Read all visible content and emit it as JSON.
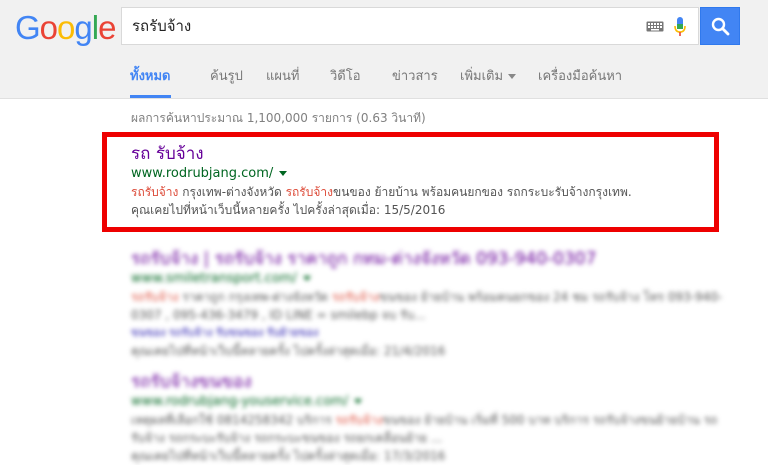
{
  "colors": {
    "accent": "#4285f4",
    "highlight": "#ee0000",
    "visited_link": "#660099",
    "url_green": "#006621",
    "query_red": "#dd4b39"
  },
  "header": {
    "logo_letters": [
      "G",
      "o",
      "o",
      "g",
      "l",
      "e"
    ],
    "logo_colors": [
      "#4285f4",
      "#ea4335",
      "#fbbc05",
      "#4285f4",
      "#34a853",
      "#ea4335"
    ],
    "search": {
      "value": "รถรับจ้าง",
      "keyboard_icon": "keyboard-icon",
      "mic_icon": "microphone-icon",
      "button_icon": "search-icon"
    }
  },
  "tabs": [
    {
      "label": "ทั้งหมด",
      "active": true
    },
    {
      "label": "ค้นรูป"
    },
    {
      "label": "แผนที่"
    },
    {
      "label": "วิดีโอ"
    },
    {
      "label": "ข่าวสาร"
    },
    {
      "label": "เพิ่มเติม",
      "dropdown": true
    },
    {
      "label": "เครื่องมือค้นหา"
    }
  ],
  "stats": "ผลการค้นหาประมาณ 1,100,000 รายการ (0.63 วินาที)",
  "results": [
    {
      "title": "รถ รับจ้าง",
      "url": "www.rodrubjang.com/",
      "snippet_hl1": "รถรับจ้าง",
      "snippet_mid": " กรุงเทพ-ต่างจังหวัด ",
      "snippet_hl2": "รถรับจ้าง",
      "snippet_rest": "ขนของ ย้ายบ้าน พร้อมคนยกของ รถกระบะรับจ้างกรุงเทพ.",
      "visited": "คุณเคยไปที่หน้าเว็บนี้หลายครั้ง ไปครั้งล่าสุดเมื่อ: 15/5/2016"
    },
    {
      "title": "รถรับจ้าง | รถรับจ้าง ราคาถูก กทม-ต่างจังหวัด 093-940-0307",
      "url": "www.smiletransport.com/",
      "snippet_hl1": "รถรับจ้าง",
      "snippet_mid": " ราคาถูก กรุงเทพ-ต่างจังหวัด ",
      "snippet_hl2": "รถรับจ้าง",
      "snippet_rest": "ขนของ ย้ายบ้าน พร้อมคนยกของ 24 ชม รถรับจ้าง โทร 093-940-0307 , 095-436-3479 , ID LINE = smilebp จบ รับ...",
      "sitelinks": "ขนของ   รถรับจ้าง   รับขนของ   รับย้ายของ",
      "visited": "คุณเคยไปที่หน้าเว็บนี้หลายครั้ง ไปครั้งล่าสุดเมื่อ: 21/4/2016"
    },
    {
      "title": "รถรับจ้างขนของ",
      "url": "www.rodrubjang-youservice.com/",
      "snippet_hl1": "",
      "snippet_mid": "เหตุผลที่เลือกใช้ 0814258342 บริการ ",
      "snippet_hl2": "รถรับจ้าง",
      "snippet_rest": "ขนของ ย้ายบ้าน เริ่มที่ 500 บาท บริการ รถรับจ้างขนย้ายบ้าน รถรับจ้าง รถกระบะรับจ้าง รถกระบะขนของ รถยกเคลื่อนย้าย ...",
      "visited": "คุณเคยไปที่หน้าเว็บนี้หลายครั้ง ไปครั้งล่าสุดเมื่อ: 17/3/2016"
    }
  ]
}
